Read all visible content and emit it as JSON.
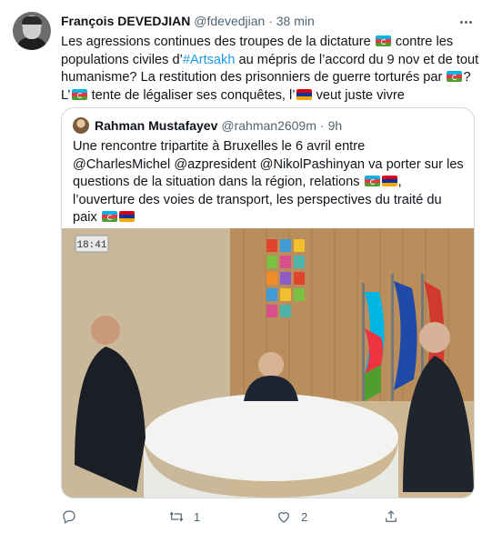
{
  "tweet": {
    "author_name": "François DEVEDJIAN",
    "author_handle": "@fdevedjian",
    "dot": "·",
    "time": "38 min",
    "text_parts": {
      "p1": "Les agressions continues des troupes de la dictature ",
      "p2": " contre les populations civiles d’",
      "hashtag": "#Artsakh",
      "p3": " au mépris de l’accord du 9 nov et de tout humanisme? La restitution des prisonniers de guerre torturés par ",
      "p4": "? L’",
      "p5": " tente de légaliser ses conquêtes, l’",
      "p6": " veut juste vivre"
    }
  },
  "quoted": {
    "author_name": "Rahman Mustafayev",
    "author_handle": "@rahman2609m",
    "dot": "·",
    "time": "9h",
    "text_parts": {
      "p1": "Une rencontre tripartite à Bruxelles le 6 avril entre @CharlesMichel @azpresident @NikolPashinyan va porter sur les questions de la situation dans la région, relations ",
      "p2": ", l’ouverture des voies  de transport, les perspectives du traité du paix "
    },
    "photo_clock": "18:41"
  },
  "actions": {
    "reply_count": "",
    "retweet_count": "1",
    "like_count": "2"
  },
  "colors": {
    "text": "#0f1419",
    "secondary": "#536471",
    "accent": "#1d9bf0",
    "border": "#cfd9de"
  },
  "icons": [
    "more-icon",
    "reply-icon",
    "retweet-icon",
    "like-icon",
    "share-icon",
    "flag-azerbaijan-icon",
    "flag-armenia-icon"
  ]
}
